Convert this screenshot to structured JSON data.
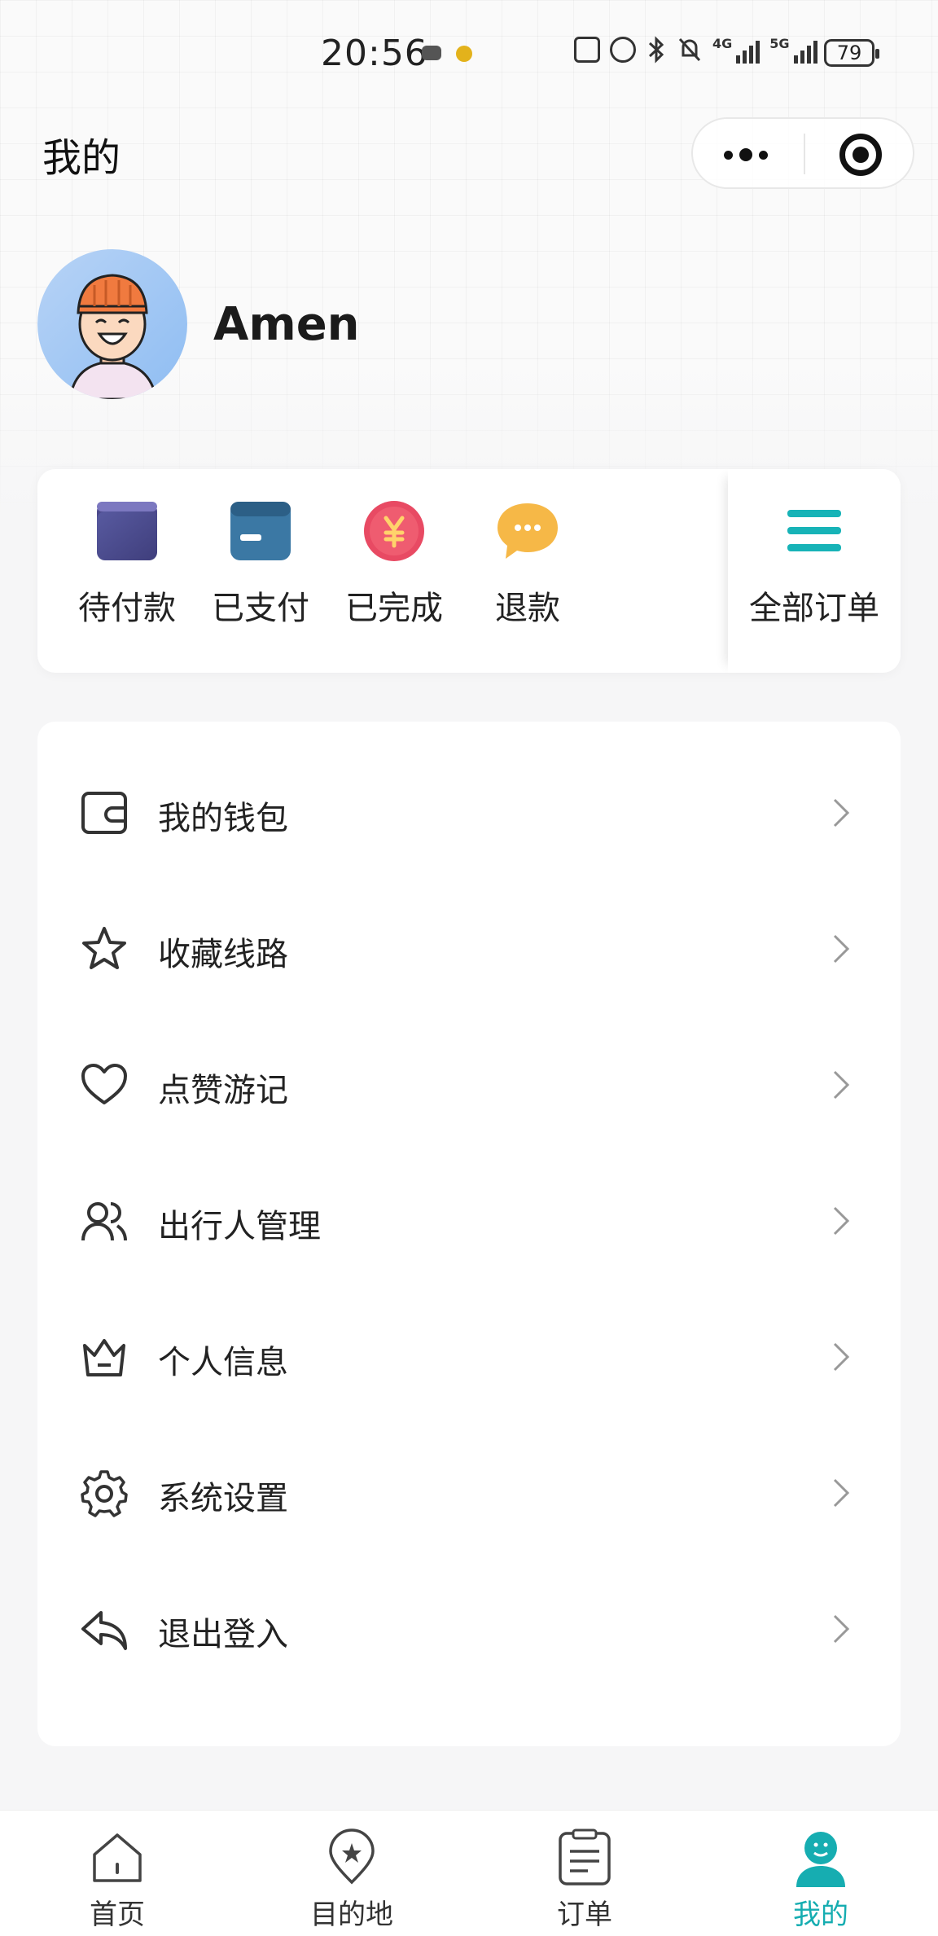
{
  "status_bar": {
    "time": "20:56",
    "battery": "79",
    "net1": "4G",
    "net2": "5G"
  },
  "header": {
    "title": "我的"
  },
  "profile": {
    "name": "Amen"
  },
  "orders": [
    {
      "label": "待付款",
      "icon": "wallet-card-icon"
    },
    {
      "label": "已支付",
      "icon": "card-icon"
    },
    {
      "label": "已完成",
      "icon": "yuan-coin-icon"
    },
    {
      "label": "退款",
      "icon": "chat-bubble-icon"
    },
    {
      "label": "全部订单",
      "icon": "menu-lines-icon"
    }
  ],
  "menu": [
    {
      "label": "我的钱包",
      "icon": "wallet-icon"
    },
    {
      "label": "收藏线路",
      "icon": "star-icon"
    },
    {
      "label": "点赞游记",
      "icon": "heart-icon"
    },
    {
      "label": "出行人管理",
      "icon": "users-icon"
    },
    {
      "label": "个人信息",
      "icon": "crown-icon"
    },
    {
      "label": "系统设置",
      "icon": "gear-icon"
    },
    {
      "label": "退出登入",
      "icon": "reply-icon"
    }
  ],
  "tabs": [
    {
      "label": "首页",
      "icon": "home-icon"
    },
    {
      "label": "目的地",
      "icon": "location-pin-icon"
    },
    {
      "label": "订单",
      "icon": "document-icon"
    },
    {
      "label": "我的",
      "icon": "user-icon",
      "active": true
    }
  ],
  "colors": {
    "accent": "#16adb1",
    "background": "#f6f6f7",
    "card": "#ffffff"
  }
}
